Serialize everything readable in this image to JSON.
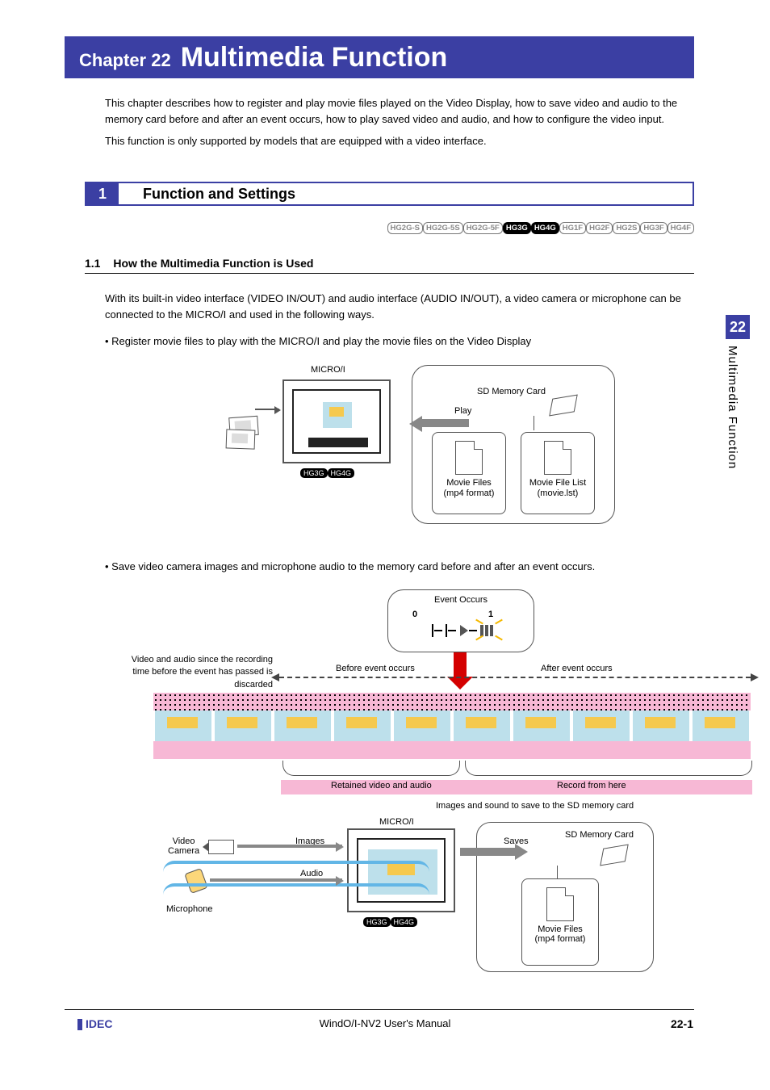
{
  "header": {
    "chapter": "Chapter 22",
    "title": "Multimedia Function"
  },
  "intro": {
    "p1": "This chapter describes how to register and play movie files played on the Video Display, how to save video and audio to the memory card before and after an event occurs, how to play saved video and audio, and how to configure the video input.",
    "p2": "This function is only supported by models that are equipped with a video interface."
  },
  "section1": {
    "num": "1",
    "title": "Function and Settings"
  },
  "model_tags": {
    "items": [
      "HG2G-S",
      "HG2G-5S",
      "HG2G-5F",
      "HG3G",
      "HG4G",
      "HG1F",
      "HG2F",
      "HG2S",
      "HG3F",
      "HG4F"
    ],
    "active": [
      "HG3G",
      "HG4G"
    ]
  },
  "sub1": {
    "num": "1.1",
    "title": "How the Multimedia Function is Used"
  },
  "body": {
    "p1": "With its built-in video interface (VIDEO IN/OUT) and audio interface (AUDIO IN/OUT), a video camera or microphone can be connected to the MICRO/I and used in the following ways.",
    "bullet1": "• Register movie files to play with the MICRO/I and play the movie files on the Video Display",
    "bullet2": "• Save video camera images and microphone audio to the memory card before and after an event occurs."
  },
  "fig1": {
    "microi": "MICRO/I",
    "tags": [
      "HG3G",
      "HG4G"
    ],
    "sd_label": "SD Memory Card",
    "play": "Play",
    "movie_files": "Movie Files",
    "movie_files_fmt": "(mp4 format)",
    "movie_list": "Movie File List",
    "movie_list_file": "(movie.lst)"
  },
  "fig2": {
    "event": "Event Occurs",
    "zero": "0",
    "one": "1",
    "left_text": "Video and audio since the recording time before the event has passed is discarded",
    "before": "Before event occurs",
    "after": "After event occurs",
    "retained": "Retained video and audio",
    "record": "Record from here",
    "save_caption": "Images and sound to save to the SD memory card",
    "microi": "MICRO/I",
    "tags": [
      "HG3G",
      "HG4G"
    ],
    "video_camera": "Video\nCamera",
    "microphone": "Microphone",
    "images": "Images",
    "audio": "Audio",
    "saves": "Saves",
    "sd_label": "SD Memory Card",
    "movie_files": "Movie Files",
    "movie_files_fmt": "(mp4 format)"
  },
  "side": {
    "num": "22",
    "text": "Multimedia Function"
  },
  "footer": {
    "brand": "IDEC",
    "center": "WindO/I-NV2 User's Manual",
    "page": "22-1"
  }
}
